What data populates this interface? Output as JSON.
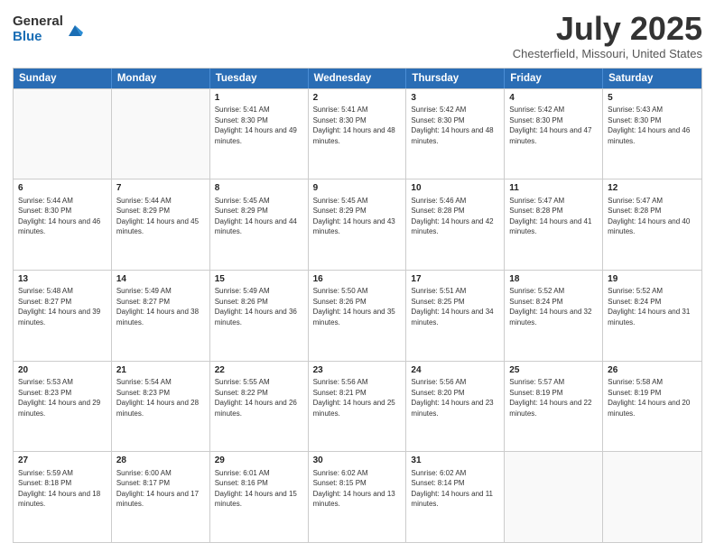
{
  "logo": {
    "general": "General",
    "blue": "Blue"
  },
  "title": "July 2025",
  "subtitle": "Chesterfield, Missouri, United States",
  "headers": [
    "Sunday",
    "Monday",
    "Tuesday",
    "Wednesday",
    "Thursday",
    "Friday",
    "Saturday"
  ],
  "weeks": [
    [
      {
        "day": "",
        "sunrise": "",
        "sunset": "",
        "daylight": ""
      },
      {
        "day": "",
        "sunrise": "",
        "sunset": "",
        "daylight": ""
      },
      {
        "day": "1",
        "sunrise": "Sunrise: 5:41 AM",
        "sunset": "Sunset: 8:30 PM",
        "daylight": "Daylight: 14 hours and 49 minutes."
      },
      {
        "day": "2",
        "sunrise": "Sunrise: 5:41 AM",
        "sunset": "Sunset: 8:30 PM",
        "daylight": "Daylight: 14 hours and 48 minutes."
      },
      {
        "day": "3",
        "sunrise": "Sunrise: 5:42 AM",
        "sunset": "Sunset: 8:30 PM",
        "daylight": "Daylight: 14 hours and 48 minutes."
      },
      {
        "day": "4",
        "sunrise": "Sunrise: 5:42 AM",
        "sunset": "Sunset: 8:30 PM",
        "daylight": "Daylight: 14 hours and 47 minutes."
      },
      {
        "day": "5",
        "sunrise": "Sunrise: 5:43 AM",
        "sunset": "Sunset: 8:30 PM",
        "daylight": "Daylight: 14 hours and 46 minutes."
      }
    ],
    [
      {
        "day": "6",
        "sunrise": "Sunrise: 5:44 AM",
        "sunset": "Sunset: 8:30 PM",
        "daylight": "Daylight: 14 hours and 46 minutes."
      },
      {
        "day": "7",
        "sunrise": "Sunrise: 5:44 AM",
        "sunset": "Sunset: 8:29 PM",
        "daylight": "Daylight: 14 hours and 45 minutes."
      },
      {
        "day": "8",
        "sunrise": "Sunrise: 5:45 AM",
        "sunset": "Sunset: 8:29 PM",
        "daylight": "Daylight: 14 hours and 44 minutes."
      },
      {
        "day": "9",
        "sunrise": "Sunrise: 5:45 AM",
        "sunset": "Sunset: 8:29 PM",
        "daylight": "Daylight: 14 hours and 43 minutes."
      },
      {
        "day": "10",
        "sunrise": "Sunrise: 5:46 AM",
        "sunset": "Sunset: 8:28 PM",
        "daylight": "Daylight: 14 hours and 42 minutes."
      },
      {
        "day": "11",
        "sunrise": "Sunrise: 5:47 AM",
        "sunset": "Sunset: 8:28 PM",
        "daylight": "Daylight: 14 hours and 41 minutes."
      },
      {
        "day": "12",
        "sunrise": "Sunrise: 5:47 AM",
        "sunset": "Sunset: 8:28 PM",
        "daylight": "Daylight: 14 hours and 40 minutes."
      }
    ],
    [
      {
        "day": "13",
        "sunrise": "Sunrise: 5:48 AM",
        "sunset": "Sunset: 8:27 PM",
        "daylight": "Daylight: 14 hours and 39 minutes."
      },
      {
        "day": "14",
        "sunrise": "Sunrise: 5:49 AM",
        "sunset": "Sunset: 8:27 PM",
        "daylight": "Daylight: 14 hours and 38 minutes."
      },
      {
        "day": "15",
        "sunrise": "Sunrise: 5:49 AM",
        "sunset": "Sunset: 8:26 PM",
        "daylight": "Daylight: 14 hours and 36 minutes."
      },
      {
        "day": "16",
        "sunrise": "Sunrise: 5:50 AM",
        "sunset": "Sunset: 8:26 PM",
        "daylight": "Daylight: 14 hours and 35 minutes."
      },
      {
        "day": "17",
        "sunrise": "Sunrise: 5:51 AM",
        "sunset": "Sunset: 8:25 PM",
        "daylight": "Daylight: 14 hours and 34 minutes."
      },
      {
        "day": "18",
        "sunrise": "Sunrise: 5:52 AM",
        "sunset": "Sunset: 8:24 PM",
        "daylight": "Daylight: 14 hours and 32 minutes."
      },
      {
        "day": "19",
        "sunrise": "Sunrise: 5:52 AM",
        "sunset": "Sunset: 8:24 PM",
        "daylight": "Daylight: 14 hours and 31 minutes."
      }
    ],
    [
      {
        "day": "20",
        "sunrise": "Sunrise: 5:53 AM",
        "sunset": "Sunset: 8:23 PM",
        "daylight": "Daylight: 14 hours and 29 minutes."
      },
      {
        "day": "21",
        "sunrise": "Sunrise: 5:54 AM",
        "sunset": "Sunset: 8:23 PM",
        "daylight": "Daylight: 14 hours and 28 minutes."
      },
      {
        "day": "22",
        "sunrise": "Sunrise: 5:55 AM",
        "sunset": "Sunset: 8:22 PM",
        "daylight": "Daylight: 14 hours and 26 minutes."
      },
      {
        "day": "23",
        "sunrise": "Sunrise: 5:56 AM",
        "sunset": "Sunset: 8:21 PM",
        "daylight": "Daylight: 14 hours and 25 minutes."
      },
      {
        "day": "24",
        "sunrise": "Sunrise: 5:56 AM",
        "sunset": "Sunset: 8:20 PM",
        "daylight": "Daylight: 14 hours and 23 minutes."
      },
      {
        "day": "25",
        "sunrise": "Sunrise: 5:57 AM",
        "sunset": "Sunset: 8:19 PM",
        "daylight": "Daylight: 14 hours and 22 minutes."
      },
      {
        "day": "26",
        "sunrise": "Sunrise: 5:58 AM",
        "sunset": "Sunset: 8:19 PM",
        "daylight": "Daylight: 14 hours and 20 minutes."
      }
    ],
    [
      {
        "day": "27",
        "sunrise": "Sunrise: 5:59 AM",
        "sunset": "Sunset: 8:18 PM",
        "daylight": "Daylight: 14 hours and 18 minutes."
      },
      {
        "day": "28",
        "sunrise": "Sunrise: 6:00 AM",
        "sunset": "Sunset: 8:17 PM",
        "daylight": "Daylight: 14 hours and 17 minutes."
      },
      {
        "day": "29",
        "sunrise": "Sunrise: 6:01 AM",
        "sunset": "Sunset: 8:16 PM",
        "daylight": "Daylight: 14 hours and 15 minutes."
      },
      {
        "day": "30",
        "sunrise": "Sunrise: 6:02 AM",
        "sunset": "Sunset: 8:15 PM",
        "daylight": "Daylight: 14 hours and 13 minutes."
      },
      {
        "day": "31",
        "sunrise": "Sunrise: 6:02 AM",
        "sunset": "Sunset: 8:14 PM",
        "daylight": "Daylight: 14 hours and 11 minutes."
      },
      {
        "day": "",
        "sunrise": "",
        "sunset": "",
        "daylight": ""
      },
      {
        "day": "",
        "sunrise": "",
        "sunset": "",
        "daylight": ""
      }
    ]
  ]
}
